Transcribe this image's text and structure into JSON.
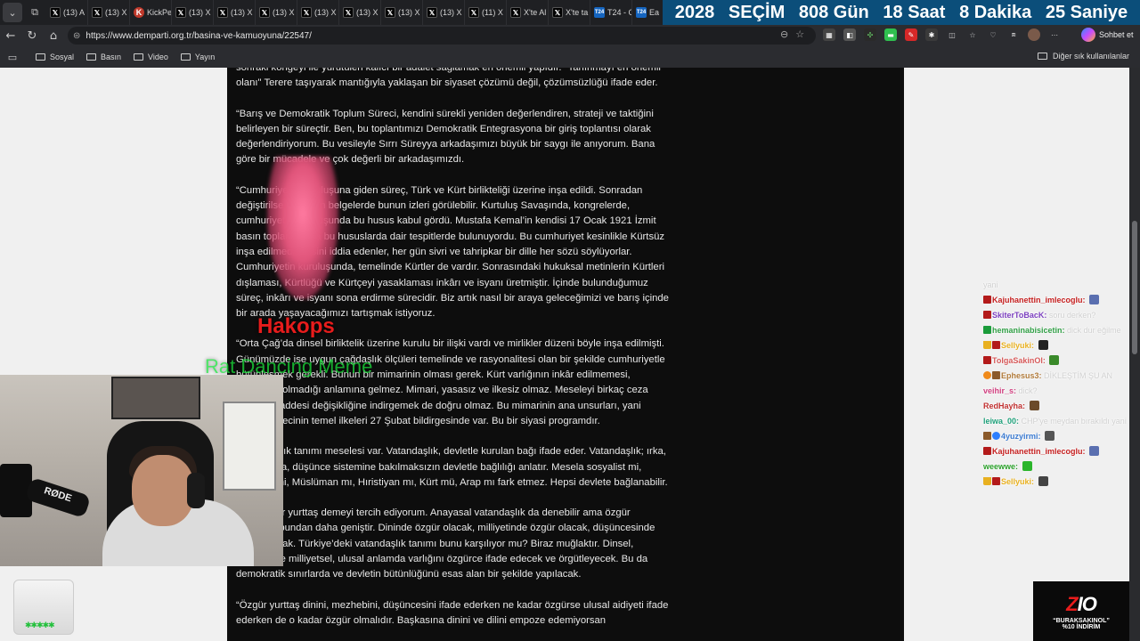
{
  "browser": {
    "tabs": [
      {
        "icon": "x-icon",
        "label": "(13) A"
      },
      {
        "icon": "x-icon",
        "label": "(13) X"
      },
      {
        "icon": "kick-icon",
        "label": "KickPe"
      },
      {
        "icon": "x-icon",
        "label": "(13) X"
      },
      {
        "icon": "x-icon",
        "label": "(13) X"
      },
      {
        "icon": "x-icon",
        "label": "(13) X"
      },
      {
        "icon": "x-icon",
        "label": "(13) X"
      },
      {
        "icon": "x-icon",
        "label": "(13) X"
      },
      {
        "icon": "x-icon",
        "label": "(13) X"
      },
      {
        "icon": "x-icon",
        "label": "(13) X"
      },
      {
        "icon": "x-icon",
        "label": "(11) X"
      },
      {
        "icon": "x-icon",
        "label": "X'te Al"
      },
      {
        "icon": "x-icon",
        "label": "X'te ta"
      },
      {
        "icon": "t24-icon",
        "label": "T24 - C"
      },
      {
        "icon": "t24-icon",
        "label": "Ea"
      }
    ],
    "url": "https://www.demparti.org.tr/basina-ve-kamuoyuna/22547/",
    "chat_button": "Sohbet et",
    "bookmarks": [
      "Sosyal",
      "Basın",
      "Video",
      "Yayın"
    ],
    "other_bookmarks": "Diğer sık kullanılanlar"
  },
  "countdown": {
    "year_label": "2028",
    "event": "SEÇİM",
    "days": "808 Gün",
    "hours": "18 Saat",
    "minutes": "8 Dakika",
    "seconds": "25 Saniye"
  },
  "article": {
    "paragraphs": [
      "sonraki kongeyi ile yürütülen kalıcı bir adalet sağlamak en önemli yapıdır. \"Tanınmayı en önemli olanı\" Terere taşıyarak mantığıyla yaklaşan bir siyaset çözümü değil, çözümsüzlüğü ifade eder.",
      "“Barış ve Demokratik Toplum Süreci, kendini sürekli yeniden değerlendiren, strateji ve taktiğini belirleyen bir süreçtir. Ben, bu toplantımızı Demokratik Entegrasyona bir giriş toplantısı olarak değerlendiriyorum. Bu vesileyle Sırrı Süreyya arkadaşımızı büyük bir saygı ile anıyorum. Bana göre bir mücadele ve çok değerli bir arkadaşımızdı.",
      "“Cumhuriyetin kuruluşuna giden süreç, Türk ve Kürt birlikteliği üzerine inşa edildi. Sonradan değiştirilse de bütün belgelerde bunun izleri görülebilir.  Kurtuluş Savaşında, kongrelerde, cumhuriyetin kuruluşunda bu husus kabul gördü. Mustafa Kemal’in kendisi 17 Ocak 1921 İzmit basın toplantısında bu hususlarda dair tespitlerde bulunuyordu. Bu cumhuriyet kesinlikle Kürtsüz inşa edilmedi. Aksini iddia edenler, her gün sivri ve tahripkar bir dille her sözü söylüyorlar. Cumhuriyetin kuruluşunda, temelinde Kürtler de vardır. Sonrasındaki hukuksal metinlerin Kürtleri dışlaması, Kürtlüğü ve Kürtçeyi yasaklaması inkârı ve isyanı üretmiştir. İçinde bulunduğumuz süreç, inkârı ve isyanı sona erdirme sürecidir. Biz artık nasıl bir araya geleceğimizi ve barış içinde bir arada yaşayacağımızı tartışmak istiyoruz.",
      "“Orta Çağ’da dinsel birliktelik üzerine kurulu bir ilişki vardı ve mirlikler düzeni böyle inşa edilmişti. Günümüzde ise uygun çağdaşlık ölçüleri temelinde ve rasyonalitesi olan bir şekilde cumhuriyetle bütünleşmek gerekli. Bunun bir mimarinin olması gerek. Kürt varlığının inkâr edilmemesi, mimarinin olmadığı anlamına gelmez. Mimari, yasasız ve ilkesiz olmaz. Meseleyi birkaç ceza hukuku maddesi değişikliğine indirgemek de doğru olmaz. Bu mimarinin ana unsurları, yani çözüm sürecinin temel ilkeleri 27 Şubat bildirgesinde var. Bu bir siyasi programdır.",
      "“Vatandaşlık tanımı meselesi var. Vatandaşlık, devletle kurulan bağı ifade eder. Vatandaşlık; ırka, dile, inanca, düşünce sistemine bakılmaksızın devletle bağlılığı anlatır. Mesela sosyalist mi, liberalist mi, Müslüman mı, Hıristiyan mı, Kürt mü, Arap mı fark etmez. Hepsi devlete bağlanabilir.",
      "“Ben özgür yurttaş demeyi tercih ediyorum. Anayasal vatandaşlık da denebilir ama özgür yurttaşlık bundan daha geniştir. Dininde özgür olacak, milliyetinde özgür olacak, düşüncesinde özgür olacak. Türkiye’deki vatandaşlık tanımı bunu karşılıyor mu? Biraz muğlaktır. Dinsel, ideolojik ve milliyetsel, ulusal anlamda varlığını özgürce ifade edecek ve örgütleyecek. Bu da demokratik sınırlarda ve devletin bütünlüğünü esas alan bir şekilde yapılacak.",
      "“Özgür yurttaş dinini, mezhebini, düşüncesini ifade ederken ne kadar özgürse ulusal aidiyeti ifade ederken de o kadar özgür olmalıdır. Başkasına dinini ve dilini empoze edemiyorsan"
    ]
  },
  "overlay": {
    "name_tag": "Hakops",
    "meme_label": "Rat Dancing Meme",
    "mic_brand": "RØDE"
  },
  "chat": {
    "messages": [
      {
        "badges": [],
        "user": "",
        "text": "yani",
        "color": "#ffffff"
      },
      {
        "badges": [
          "b-red"
        ],
        "user": "Kajuhanettin_imlecoglu:",
        "text": "",
        "color": "#c41e1e",
        "emote": "#5a6fb0"
      },
      {
        "badges": [
          "b-red"
        ],
        "user": "SkiterToBacK:",
        "text": "soru derken?",
        "color": "#7b3fbf"
      },
      {
        "badges": [
          "b-green"
        ],
        "user": "hemaninabisicetin:",
        "text": "dick dur eğilme",
        "color": "#2f9e44"
      },
      {
        "badges": [
          "b-crown",
          "b-red"
        ],
        "user": "Sellyuki:",
        "text": "",
        "color": "#e8b020",
        "emote": "#222222"
      },
      {
        "badges": [
          "b-red"
        ],
        "user": "TolgaSakinOl:",
        "text": "",
        "color": "#d65a5a",
        "emote": "#3a8a2a"
      },
      {
        "badges": [
          "b-orange",
          "b-brown"
        ],
        "user": "Ephesus3:",
        "text": "DİKLEŞTİM ŞU AN",
        "color": "#b07a3a"
      },
      {
        "badges": [],
        "user": "veihir_s:",
        "text": "dick?",
        "color": "#d04080"
      },
      {
        "badges": [],
        "user": "RedHayha:",
        "text": "",
        "color": "#c03030",
        "emote": "#6b4a2a"
      },
      {
        "badges": [],
        "user": "leiwa_00:",
        "text": "CHP'ye meydan bırakıldı yani",
        "color": "#1fa07a"
      },
      {
        "badges": [
          "b-brown",
          "b-blue"
        ],
        "user": "4yuzyirmi:",
        "text": "",
        "color": "#3a7ad0",
        "emote": "#555555"
      },
      {
        "badges": [
          "b-red"
        ],
        "user": "Kajuhanettin_imlecoglu:",
        "text": "",
        "color": "#c41e1e",
        "emote": "#5a6fb0"
      },
      {
        "badges": [],
        "user": "weewwe:",
        "text": "",
        "color": "#2aa02a",
        "emote": "#2bb52b"
      },
      {
        "badges": [
          "b-crown",
          "b-red"
        ],
        "user": "Sellyuki:",
        "text": "",
        "color": "#e8b020",
        "emote": "#444444"
      }
    ]
  },
  "sponsor": {
    "logo_prefix": "Z",
    "logo_suffix": "IO",
    "code": "“BURAKSAKINOL”",
    "discount": "%10 İNDİRİM"
  }
}
